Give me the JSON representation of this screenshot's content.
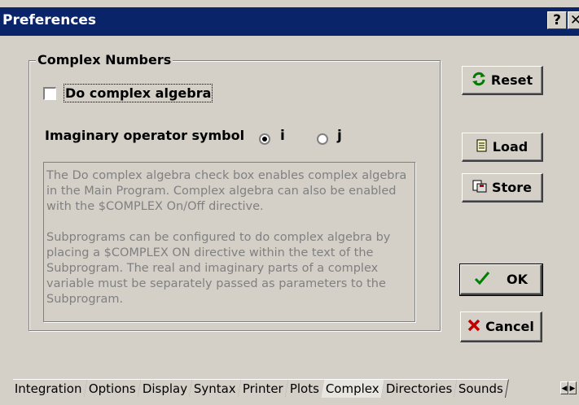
{
  "window": {
    "title": "Preferences",
    "help_label": "?",
    "close_label": "✕"
  },
  "group": {
    "title": "Complex Numbers",
    "checkbox_label": "Do complex algebra",
    "checkbox_checked": false,
    "operator_label": "Imaginary operator symbol",
    "radio_options": [
      "i",
      "j"
    ],
    "radio_selected": "i",
    "description_p1": "The Do complex algebra check box enables complex algebra in the Main Program.  Complex algebra can also be enabled with the $COMPLEX On/Off directive.",
    "description_p2": "Subprograms can be configured to do complex algebra by placing a $COMPLEX ON directive within the text of the Subprogram.  The real and imaginary parts of a complex variable must be separately passed as parameters to the Subprogram."
  },
  "buttons": {
    "reset": "Reset",
    "load": "Load",
    "store": "Store",
    "ok": "OK",
    "cancel": "Cancel"
  },
  "icons": {
    "reset": "refresh-icon",
    "load": "document-icon",
    "store": "save-icon",
    "ok": "checkmark-icon",
    "cancel": "x-icon"
  },
  "colors": {
    "titlebar": "#0a246a",
    "ok_check": "#008000",
    "cancel_x": "#c00000",
    "reset_icon": "#007a00"
  },
  "tabs": [
    "Integration",
    "Options",
    "Display",
    "Syntax",
    "Printer",
    "Plots",
    "Complex",
    "Directories",
    "Sounds"
  ],
  "active_tab": "Complex"
}
